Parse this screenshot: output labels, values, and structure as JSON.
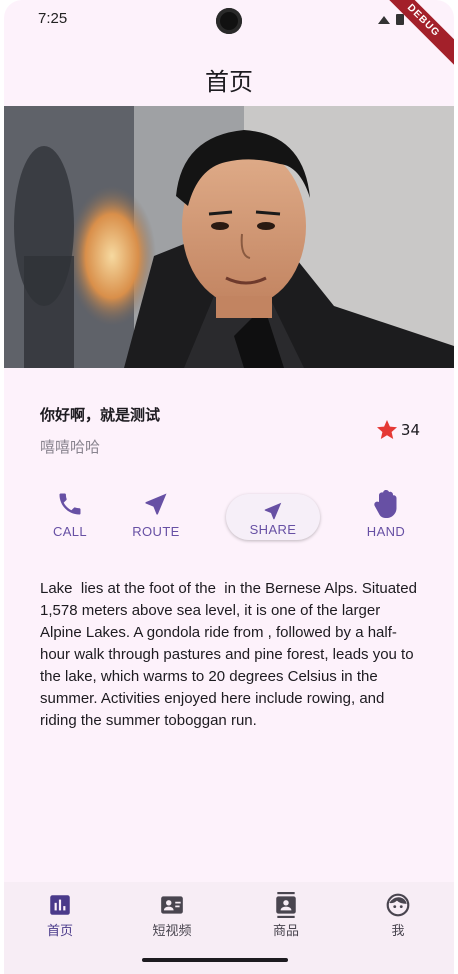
{
  "status_bar": {
    "time": "7:25",
    "debug_label": "DEBUG"
  },
  "app_bar": {
    "title": "首页"
  },
  "hero": {
    "image_icon": "portrait-photo"
  },
  "title_section": {
    "title": "你好啊，就是测试",
    "subtitle": "嘻嘻哈哈",
    "rating_count": "34",
    "star_color": "#e53935"
  },
  "buttons": [
    {
      "label": "CALL",
      "icon": "phone-icon"
    },
    {
      "label": "ROUTE",
      "icon": "navigation-arrow-icon"
    },
    {
      "label": "SHARE",
      "icon": "share-arrow-icon"
    },
    {
      "label": "HAND",
      "icon": "hand-icon"
    }
  ],
  "body_text": "Lake  lies at the foot of the  in the Bernese Alps. Situated 1,578 meters above sea level, it is one of the larger Alpine Lakes. A gondola ride from , followed by a half-hour walk through pastures and pine forest, leads you to the lake, which warms to 20 degrees Celsius in the summer. Activities enjoyed here include rowing, and riding the summer toboggan run.",
  "bottom_nav": [
    {
      "label": "首页",
      "icon": "bar-chart-icon",
      "active": true
    },
    {
      "label": "短视频",
      "icon": "contact-card-icon",
      "active": false
    },
    {
      "label": "商品",
      "icon": "contacts-book-icon",
      "active": false
    },
    {
      "label": "我",
      "icon": "face-icon",
      "active": false
    }
  ],
  "colors": {
    "primary": "#6750a4",
    "background": "#fdf2fb",
    "nav_background": "#f7edf5"
  }
}
